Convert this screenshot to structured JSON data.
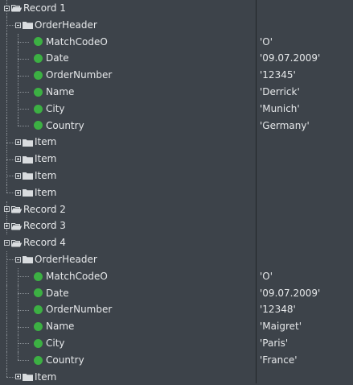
{
  "tree": [
    {
      "label": "Record 1",
      "kind": "record",
      "expanded": true,
      "level": 0,
      "value": ""
    },
    {
      "label": "OrderHeader",
      "kind": "group",
      "expanded": true,
      "level": 1,
      "value": ""
    },
    {
      "label": "MatchCodeO",
      "kind": "field",
      "level": 2,
      "value": "'O'"
    },
    {
      "label": "Date",
      "kind": "field",
      "level": 2,
      "value": "'09.07.2009'"
    },
    {
      "label": "OrderNumber",
      "kind": "field",
      "level": 2,
      "value": "'12345'"
    },
    {
      "label": "Name",
      "kind": "field",
      "level": 2,
      "value": "'Derrick'"
    },
    {
      "label": "City",
      "kind": "field",
      "level": 2,
      "value": "'Munich'"
    },
    {
      "label": "Country",
      "kind": "field",
      "level": 2,
      "value": "'Germany'"
    },
    {
      "label": "Item",
      "kind": "group",
      "expanded": false,
      "level": 1,
      "value": ""
    },
    {
      "label": "Item",
      "kind": "group",
      "expanded": false,
      "level": 1,
      "value": ""
    },
    {
      "label": "Item",
      "kind": "group",
      "expanded": false,
      "level": 1,
      "value": ""
    },
    {
      "label": "Item",
      "kind": "group",
      "expanded": false,
      "level": 1,
      "value": ""
    },
    {
      "label": "Record 2",
      "kind": "record",
      "expanded": false,
      "level": 0,
      "value": ""
    },
    {
      "label": "Record 3",
      "kind": "record",
      "expanded": false,
      "level": 0,
      "value": ""
    },
    {
      "label": "Record 4",
      "kind": "record",
      "expanded": true,
      "level": 0,
      "value": ""
    },
    {
      "label": "OrderHeader",
      "kind": "group",
      "expanded": true,
      "level": 1,
      "value": ""
    },
    {
      "label": "MatchCodeO",
      "kind": "field",
      "level": 2,
      "value": "'O'"
    },
    {
      "label": "Date",
      "kind": "field",
      "level": 2,
      "value": "'09.07.2009'"
    },
    {
      "label": "OrderNumber",
      "kind": "field",
      "level": 2,
      "value": "'12348'"
    },
    {
      "label": "Name",
      "kind": "field",
      "level": 2,
      "value": "'Maigret'"
    },
    {
      "label": "City",
      "kind": "field",
      "level": 2,
      "value": "'Paris'"
    },
    {
      "label": "Country",
      "kind": "field",
      "level": 2,
      "value": "'France'"
    },
    {
      "label": "Item",
      "kind": "group",
      "expanded": false,
      "level": 1,
      "value": ""
    }
  ],
  "icons": {
    "record_open": "folder-open-icon",
    "group": "folder-icon",
    "field": "green-dot-icon"
  },
  "colors": {
    "background": "#3d434a",
    "text": "#e6e8ea",
    "field_dot": "#3cb043",
    "folder": "#d9dcdf",
    "divider": "#222629"
  }
}
